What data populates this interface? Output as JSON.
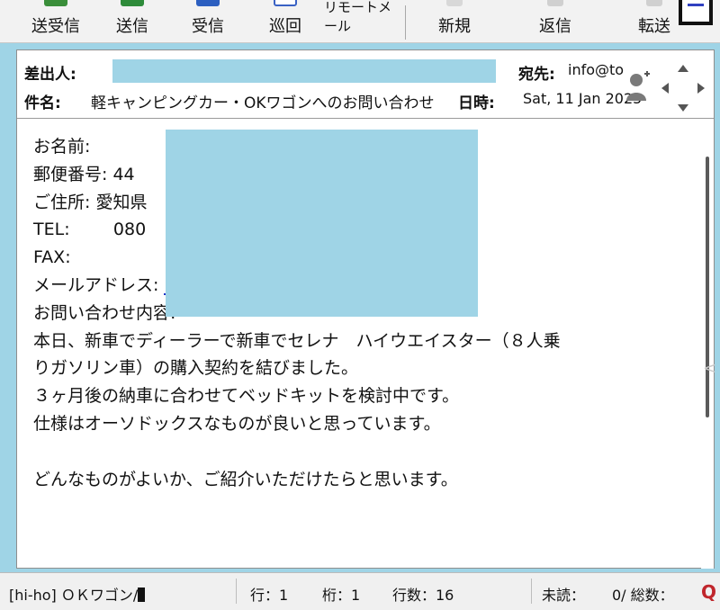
{
  "toolbar": {
    "items": [
      {
        "label": "送受信"
      },
      {
        "label": "送信"
      },
      {
        "label": "受信"
      },
      {
        "label": "巡回"
      },
      {
        "label": "リモートメール"
      },
      {
        "label": "新規"
      },
      {
        "label": "返信"
      },
      {
        "label": "転送"
      }
    ]
  },
  "header": {
    "from_label": "差出人:",
    "to_label": "宛先:",
    "to_value": "info@to",
    "subject_label": "件名:",
    "subject_value": "軽キャンピングカー・OKワゴンへのお問い合わせ",
    "date_label": "日時:",
    "date_value": "Sat, 11 Jan 2025"
  },
  "body": {
    "lines": [
      "お名前:",
      "郵便番号: 44",
      "ご住所: 愛知県",
      "TEL:        080",
      "FAX:",
      "メールアドレス: ",
      "お問い合わせ内容:",
      "本日、新車でディーラーで新車でセレナ　ハイウエイスター（８人乗",
      "りガソリン車）の購入契約を結びました。",
      "３ヶ月後の納車に合わせてベッドキットを検討中です。",
      "仕様はオーソドックスなものが良いと思っています。",
      "",
      "どんなものがよいか、ご紹介いただけたらと思います。"
    ]
  },
  "status": {
    "folder": "[hi-ho] ＯＫワゴン/",
    "row": "行：1",
    "col": "桁：1",
    "lines": "行数：16",
    "unread": "未読：",
    "total": "0/ 総数："
  },
  "colors": {
    "redaction": "#9fd4e6",
    "link": "#1a33c8",
    "status_q": "#c0262c"
  }
}
